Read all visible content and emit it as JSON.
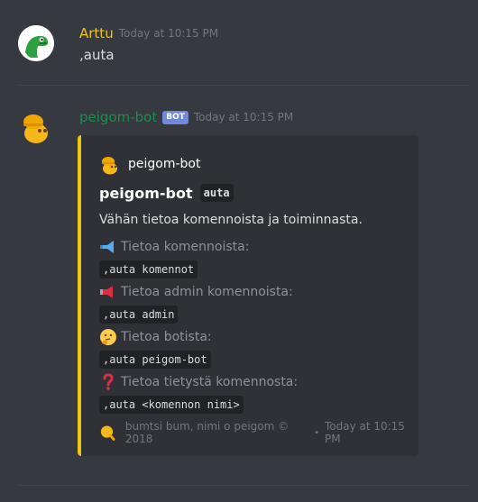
{
  "message1": {
    "author": "Arttu",
    "author_color": "#f1c40f",
    "timestamp": "Today at 10:15 PM",
    "content": ",auta"
  },
  "message2": {
    "author": "peigom-bot",
    "author_color": "#1f8b4c",
    "badge": "BOT",
    "timestamp": "Today at 10:15 PM"
  },
  "embed": {
    "accent_color": "#f1c40f",
    "author_name": "peigom-bot",
    "title": "peigom-bot",
    "title_code": "auta",
    "description": "Vähän tietoa komennoista ja toiminnasta.",
    "fields": [
      {
        "icon": "megaphone-icon",
        "name": "Tietoa komennoista:",
        "value": ",auta komennot"
      },
      {
        "icon": "loudspeaker-icon",
        "name": "Tietoa admin komennoista:",
        "value": ",auta admin"
      },
      {
        "icon": "thinking-face-icon",
        "name": "Tietoa botista:",
        "value": ",auta peigom-bot"
      },
      {
        "icon": "question-mark-icon",
        "name": "Tietoa tietystä komennosta:",
        "value": ",auta <komennon nimi>"
      }
    ],
    "footer_text": "bumtsi bum, nimi o peigom © 2018",
    "footer_separator": "•",
    "footer_timestamp": "Today at 10:15 PM"
  }
}
